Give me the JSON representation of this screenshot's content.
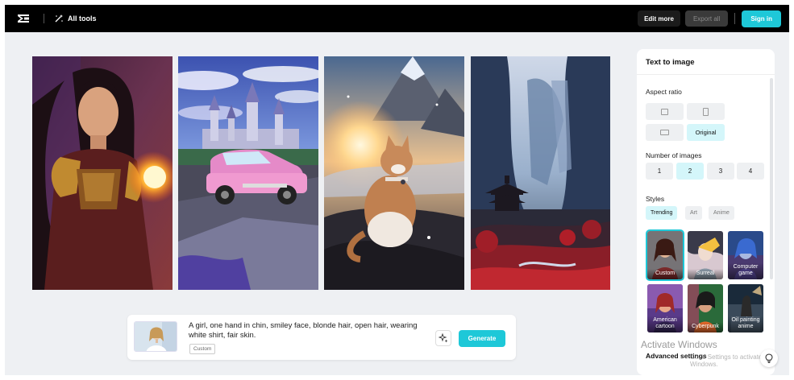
{
  "header": {
    "all_tools_label": "All tools",
    "edit_more_label": "Edit more",
    "export_all_label": "Export all",
    "sign_in_label": "Sign in"
  },
  "prompt": {
    "text": "A girl, one hand in chin, smiley face, blonde hair, open hair, wearing white shirt, fair skin.",
    "style_tag": "Custom",
    "generate_label": "Generate"
  },
  "panel": {
    "title": "Text to image",
    "aspect_ratio_label": "Aspect ratio",
    "aspect_original_label": "Original",
    "num_images_label": "Number of images",
    "num_options": [
      "1",
      "2",
      "3",
      "4"
    ],
    "selected_num": "2",
    "styles_label": "Styles",
    "style_tabs": [
      "Trending",
      "Art",
      "Anime"
    ],
    "active_tab": "Trending",
    "style_cards": [
      "Custom",
      "Surreal",
      "Computer game",
      "American cartoon",
      "Cyberpunk",
      "Oil painting anime"
    ],
    "selected_style": "Custom",
    "advanced_label": "Advanced settings"
  },
  "watermark": {
    "line1": "Activate Windows",
    "line2": "Go to Settings to activate Windows."
  },
  "colors": {
    "accent": "#1ec8d8",
    "topbar": "#000000",
    "background": "#eef0f3"
  },
  "icons": {
    "logo": "capcut-logo-icon",
    "all_tools": "magic-wand-icon",
    "magic": "sparkle-icon",
    "help": "lightbulb-icon"
  }
}
